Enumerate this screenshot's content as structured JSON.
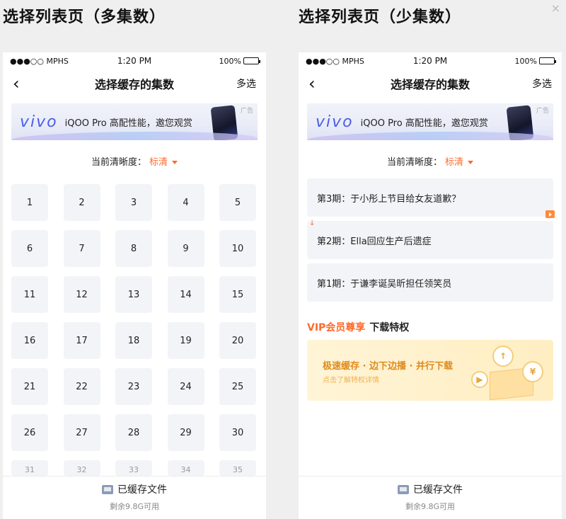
{
  "left_title": "选择列表页（多集数）",
  "right_title": "选择列表页（少集数）",
  "close_symbol": "×",
  "statusbar": {
    "carrier": "●●●○○ MPHS",
    "time": "1:20 PM",
    "battery": "100%"
  },
  "navbar": {
    "back_symbol": "‹",
    "title": "选择缓存的集数",
    "multi_select": "多选"
  },
  "ad": {
    "logo": "vivo",
    "text": "iQOO Pro 高配性能，邀您观赏",
    "tag": "广告"
  },
  "quality": {
    "label": "当前清晰度：",
    "value": "标清"
  },
  "episodes_grid": [
    "1",
    "2",
    "3",
    "4",
    "5",
    "6",
    "7",
    "8",
    "9",
    "10",
    "11",
    "12",
    "13",
    "14",
    "15",
    "16",
    "17",
    "18",
    "19",
    "20",
    "21",
    "22",
    "23",
    "24",
    "25",
    "26",
    "27",
    "28",
    "29",
    "30"
  ],
  "episodes_partial": [
    "31",
    "32",
    "33",
    "34",
    "35"
  ],
  "episodes_list": [
    {
      "label": "第3期：于小彤上节目给女友道歉？"
    },
    {
      "label": "第2期：Ella回应生产后遗症"
    },
    {
      "label": "第1期：于谦李诞吴昕担任领笑员"
    }
  ],
  "vip": {
    "title_highlight": "VIP会员尊享",
    "title_rest": "下载特权",
    "banner_main": "极速缓存 · 边下边播 · 并行下载",
    "banner_sub": "点击了解特权详情"
  },
  "footer": {
    "cached_label": "已缓存文件",
    "remaining": "剩余9.8G可用"
  },
  "colors": {
    "accent": "#ff6a2a",
    "cell_bg": "#f3f4f7",
    "vip_gold": "#e08a1c"
  }
}
